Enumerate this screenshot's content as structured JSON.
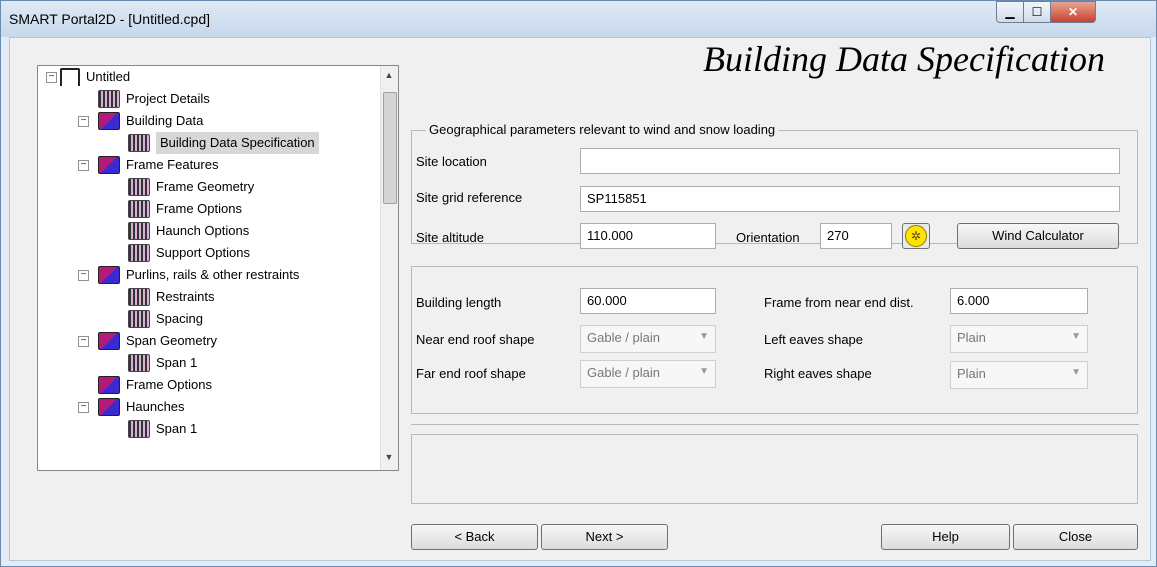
{
  "window": {
    "title": "SMART Portal2D - [Untitled.cpd]"
  },
  "tree": {
    "items": [
      {
        "label": "Untitled"
      },
      {
        "label": "Project Details"
      },
      {
        "label": "Building Data"
      },
      {
        "label": "Building Data Specification"
      },
      {
        "label": "Frame Features"
      },
      {
        "label": "Frame Geometry"
      },
      {
        "label": "Frame Options"
      },
      {
        "label": "Haunch Options"
      },
      {
        "label": "Support Options"
      },
      {
        "label": "Purlins, rails & other restraints"
      },
      {
        "label": "Restraints"
      },
      {
        "label": "Spacing"
      },
      {
        "label": "Span Geometry"
      },
      {
        "label": "Span 1"
      },
      {
        "label": "Frame Options"
      },
      {
        "label": "Haunches"
      },
      {
        "label": "Span 1"
      }
    ]
  },
  "heading": "Building Data Specification",
  "geo": {
    "title": "Geographical parameters relevant to wind and snow loading",
    "site_location_label": "Site location",
    "site_location_value": "",
    "site_grid_label": "Site grid reference",
    "site_grid_value": "SP115851",
    "site_altitude_label": "Site altitude",
    "site_altitude_value": "110.000",
    "orientation_label": "Orientation",
    "orientation_value": "270",
    "wind_calc_label": "Wind Calculator"
  },
  "building": {
    "length_label": "Building length",
    "length_value": "60.000",
    "frame_near_label": "Frame from near end dist.",
    "frame_near_value": "6.000",
    "near_roof_label": "Near end roof shape",
    "near_roof_value": "Gable / plain",
    "left_eaves_label": "Left eaves shape",
    "left_eaves_value": "Plain",
    "far_roof_label": "Far end roof shape",
    "far_roof_value": "Gable / plain",
    "right_eaves_label": "Right eaves shape",
    "right_eaves_value": "Plain"
  },
  "footer": {
    "back": "< Back",
    "next": "Next >",
    "help": "Help",
    "close": "Close"
  }
}
